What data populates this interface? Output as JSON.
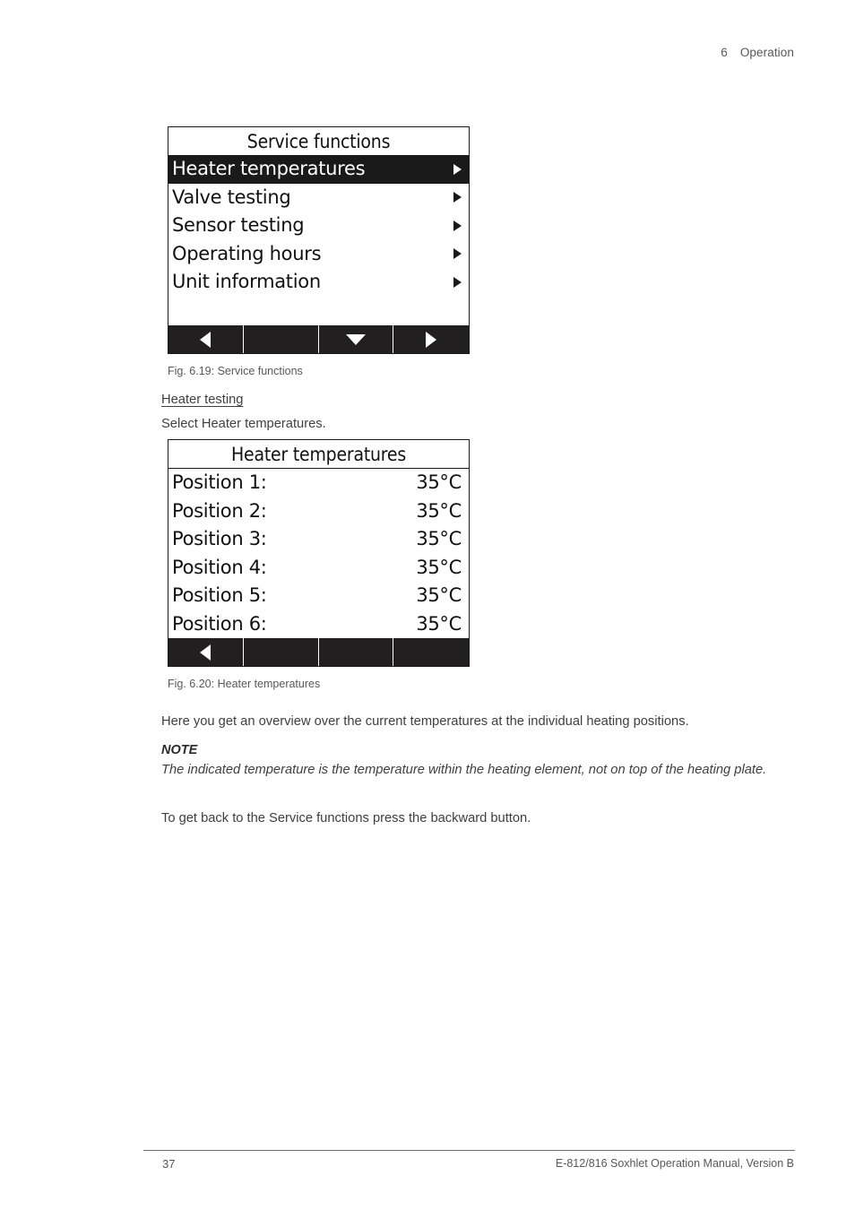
{
  "running_head": {
    "chapter_number": "6",
    "chapter_title": "Operation"
  },
  "screens": [
    {
      "id": "service-functions",
      "title": "Service functions",
      "title_ruled": false,
      "rows": [
        {
          "label": "Heater temperatures",
          "selected": true,
          "caret": true
        },
        {
          "label": "Valve testing",
          "selected": false,
          "caret": true
        },
        {
          "label": "Sensor testing",
          "selected": false,
          "caret": true
        },
        {
          "label": "Operating hours",
          "selected": false,
          "caret": true
        },
        {
          "label": "Unit information",
          "selected": false,
          "caret": true
        }
      ],
      "softkeys": [
        {
          "icon": "triangle-left-icon"
        },
        {
          "icon": "none"
        },
        {
          "icon": "triangle-down-icon"
        },
        {
          "icon": "triangle-right-icon"
        }
      ]
    },
    {
      "id": "heater-temperatures",
      "title": "Heater temperatures",
      "title_ruled": true,
      "rows": [
        {
          "label": "Position 1:",
          "value": "35°C"
        },
        {
          "label": "Position 2:",
          "value": "35°C"
        },
        {
          "label": "Position 3:",
          "value": "35°C"
        },
        {
          "label": "Position 4:",
          "value": "35°C"
        },
        {
          "label": "Position 5:",
          "value": "35°C"
        },
        {
          "label": "Position 6:",
          "value": "35°C"
        }
      ],
      "softkeys": [
        {
          "icon": "triangle-left-icon"
        },
        {
          "icon": "none"
        },
        {
          "icon": "none"
        },
        {
          "icon": "none"
        }
      ]
    }
  ],
  "captions": {
    "fig_619": "Fig. 6.19: Service functions",
    "fig_620": "Fig. 6.20: Heater temperatures"
  },
  "body": {
    "subhead": "Heater testing",
    "select_instruction": "Select Heater temperatures.",
    "overview": "Here you get an overview over the current temperatures at the individual heating positions.",
    "note_label": "NOTE",
    "note_text": "The indicated temperature is the temperature within the heating element, not on top of the heating plate.",
    "back_instruction": "To get back to the Service functions press the backward button."
  },
  "footer": {
    "page_number": "37",
    "manual_reference": "E-812/816 Soxhlet Operation Manual, Version B"
  },
  "colors": {
    "lcd_highlight": "#1a1a1a",
    "lcd_background": "#ffffff",
    "softkey_bar": "#211f1f",
    "body_text": "#3f3f3f",
    "meta_text": "#58585a"
  }
}
